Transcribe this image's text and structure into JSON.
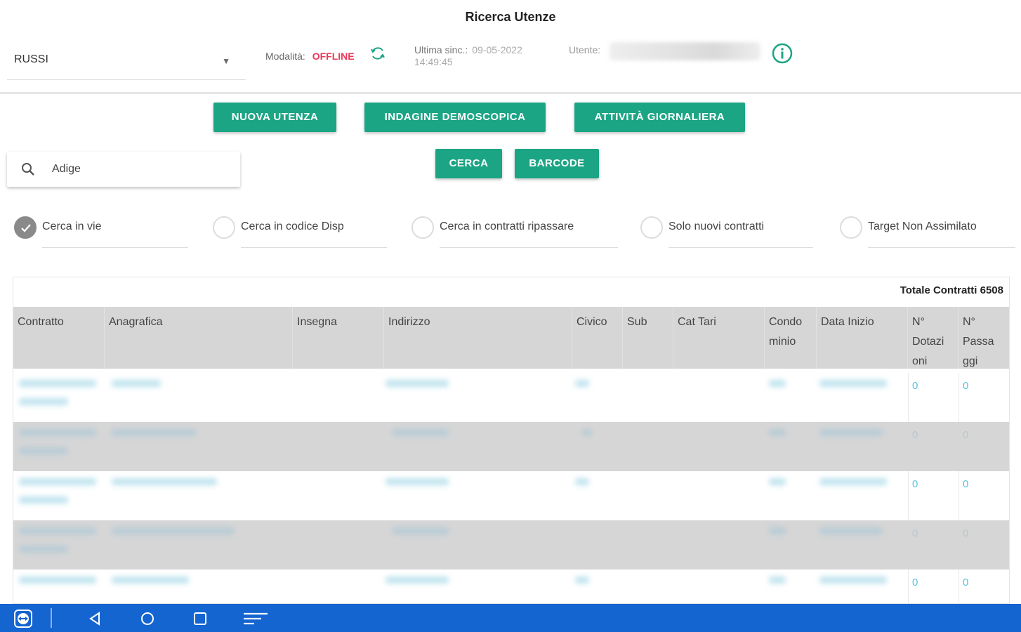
{
  "header": {
    "title": "Ricerca Utenze",
    "select_value": "RUSSI",
    "mode_label": "Modalità:",
    "mode_value": "OFFLINE",
    "last_sync_label": "Ultima sinc.:",
    "last_sync_date": "09-05-2022",
    "last_sync_time": "14:49:45",
    "user_label": "Utente:"
  },
  "actions": {
    "new_utenza": "NUOVA UTENZA",
    "survey": "INDAGINE DEMOSCOPICA",
    "daily": "ATTIVITÀ GIORNALIERA",
    "search": "CERCA",
    "barcode": "BARCODE"
  },
  "search": {
    "value": "Adige"
  },
  "filters": [
    {
      "label": "Cerca in vie",
      "checked": true
    },
    {
      "label": "Cerca in codice Disp",
      "checked": false
    },
    {
      "label": "Cerca in contratti ripassare",
      "checked": false
    },
    {
      "label": "Solo nuovi contratti",
      "checked": false
    },
    {
      "label": "Target Non Assimilato",
      "checked": false
    }
  ],
  "table": {
    "total_label": "Totale Contratti 6508",
    "columns": [
      "Contratto",
      "Anagrafica",
      "Insegna",
      "Indirizzo",
      "Civico",
      "Sub",
      "Cat Tari",
      "Condo minio",
      "Data Inizio",
      "N° Dotazi oni",
      "N° Passa ggi"
    ],
    "rows": [
      {
        "dotazioni": "0",
        "passaggi": "0"
      },
      {
        "dotazioni": "0",
        "passaggi": "0"
      },
      {
        "dotazioni": "0",
        "passaggi": "0"
      },
      {
        "dotazioni": "0",
        "passaggi": "0"
      },
      {
        "dotazioni": "0",
        "passaggi": "0"
      }
    ]
  },
  "colors": {
    "accent": "#1ba584",
    "offline": "#e8395a",
    "navbar": "#1565d0",
    "link": "#5ac2db"
  },
  "icons": [
    "sync-icon",
    "info-icon",
    "search-icon",
    "check-icon",
    "teamviewer-icon",
    "back-icon",
    "home-icon",
    "recents-icon",
    "menu-icon"
  ]
}
